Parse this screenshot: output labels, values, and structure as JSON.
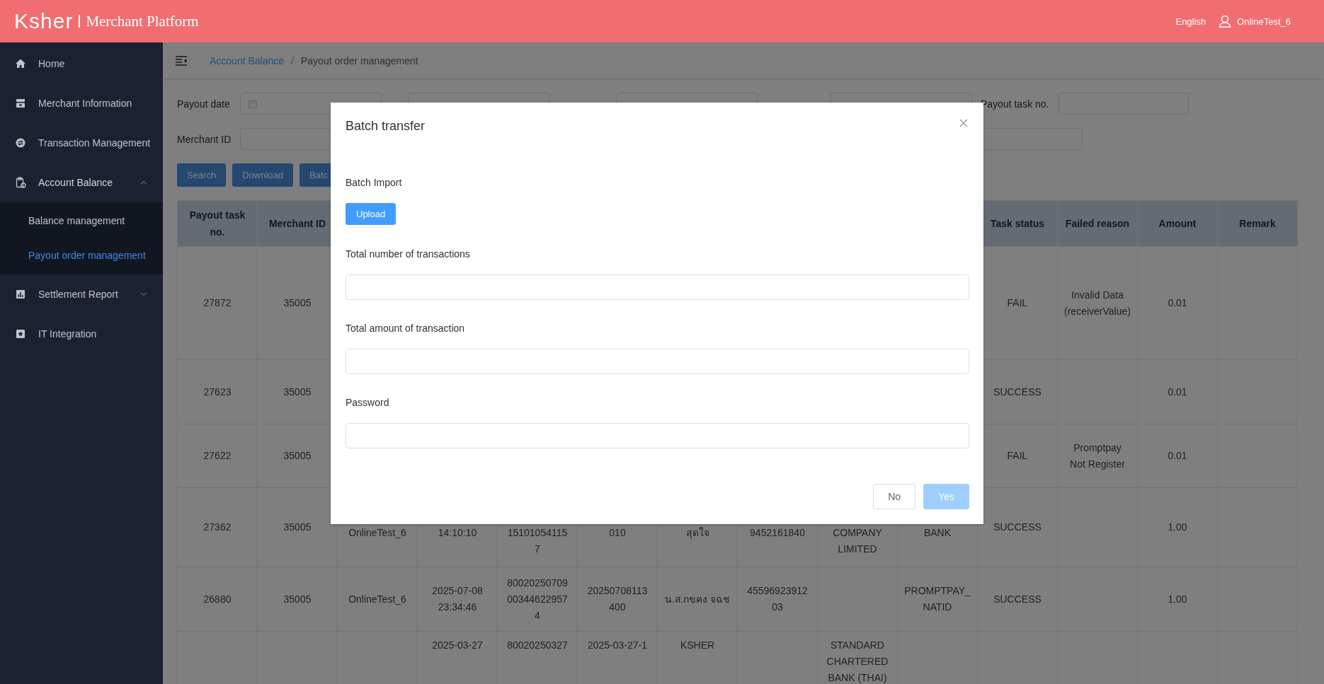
{
  "header": {
    "logo": "Ksher",
    "title": "Merchant Platform",
    "language": "English",
    "user": "OnlineTest_6"
  },
  "sidebar": {
    "items": [
      {
        "label": "Home",
        "kind": "link",
        "selected": false
      },
      {
        "label": "Merchant Information",
        "kind": "link",
        "selected": false
      },
      {
        "label": "Transaction Management",
        "kind": "link",
        "selected": false
      },
      {
        "label": "Account Balance",
        "kind": "group",
        "expanded": true,
        "selected": false,
        "children": [
          {
            "label": "Balance management",
            "selected": false
          },
          {
            "label": "Payout order management",
            "selected": true
          }
        ]
      },
      {
        "label": "Settlement Report",
        "kind": "group",
        "expanded": false,
        "selected": false
      },
      {
        "label": "IT Integration",
        "kind": "link",
        "selected": false
      }
    ]
  },
  "breadcrumb": {
    "items": [
      "Account Balance",
      "Payout order management"
    ],
    "separator": "/"
  },
  "filters": {
    "payout_date_label": "Payout date",
    "payout_task_label": "Payout task no.",
    "merchant_id_label": "Merchant ID",
    "buttons": [
      "Search",
      "Download",
      "Batc"
    ]
  },
  "table": {
    "columns": [
      "Payout task no.",
      "Merchant ID",
      null,
      null,
      null,
      null,
      null,
      null,
      null,
      null,
      "Task status",
      "Failed reason",
      "Amount",
      "Remark"
    ],
    "rows": [
      {
        "cells": [
          "27872",
          "35005",
          null,
          null,
          null,
          null,
          null,
          null,
          null,
          null,
          "FAIL",
          "Invalid Data\n(receiverValue)",
          "0.01",
          null
        ]
      },
      {
        "cells": [
          "27623",
          "35005",
          null,
          null,
          null,
          null,
          null,
          null,
          null,
          null,
          "SUCCESS",
          null,
          "0.01",
          null
        ]
      },
      {
        "cells": [
          "27622",
          "35005",
          null,
          null,
          null,
          null,
          null,
          null,
          null,
          null,
          "FAIL",
          "Promptpay\nNot Register",
          "0.01",
          null
        ]
      },
      {
        "cells": [
          "27362",
          "35005",
          "OnlineTest_6",
          "14:10:10",
          "15101054115\n7",
          "010",
          "สุดใจ",
          "9452161840",
          "COMPANY\nLIMITED",
          "BANK",
          "SUCCESS",
          null,
          "1.00",
          null
        ]
      },
      {
        "cells": [
          "26880",
          "35005",
          "OnlineTest_6",
          "2025-07-08\n23:34:46",
          "80020250709\n00344622957\n4",
          "20250708113\n400",
          "น.ส.กขคง จฉช",
          "45596923912\n03",
          null,
          "PROMPTPAY_\nNATID",
          "SUCCESS",
          null,
          "1.00",
          null
        ]
      },
      {
        "cells": [
          null,
          null,
          null,
          "2025-03-27",
          "80020250327",
          "2025-03-27-1",
          "KSHER",
          null,
          "STANDARD\nCHARTERED\nBANK (THAI)",
          null,
          null,
          null,
          null,
          null
        ]
      }
    ]
  },
  "modal": {
    "title": "Batch transfer",
    "section_label": "Batch Import",
    "upload_button": "Upload",
    "fields": [
      {
        "label": "Total number of transactions"
      },
      {
        "label": "Total amount of transaction"
      },
      {
        "label": "Password"
      }
    ],
    "buttons": [
      {
        "label": "No",
        "kind": "cancel",
        "disabled": false
      },
      {
        "label": "Yes",
        "kind": "confirm",
        "disabled": true
      }
    ]
  }
}
